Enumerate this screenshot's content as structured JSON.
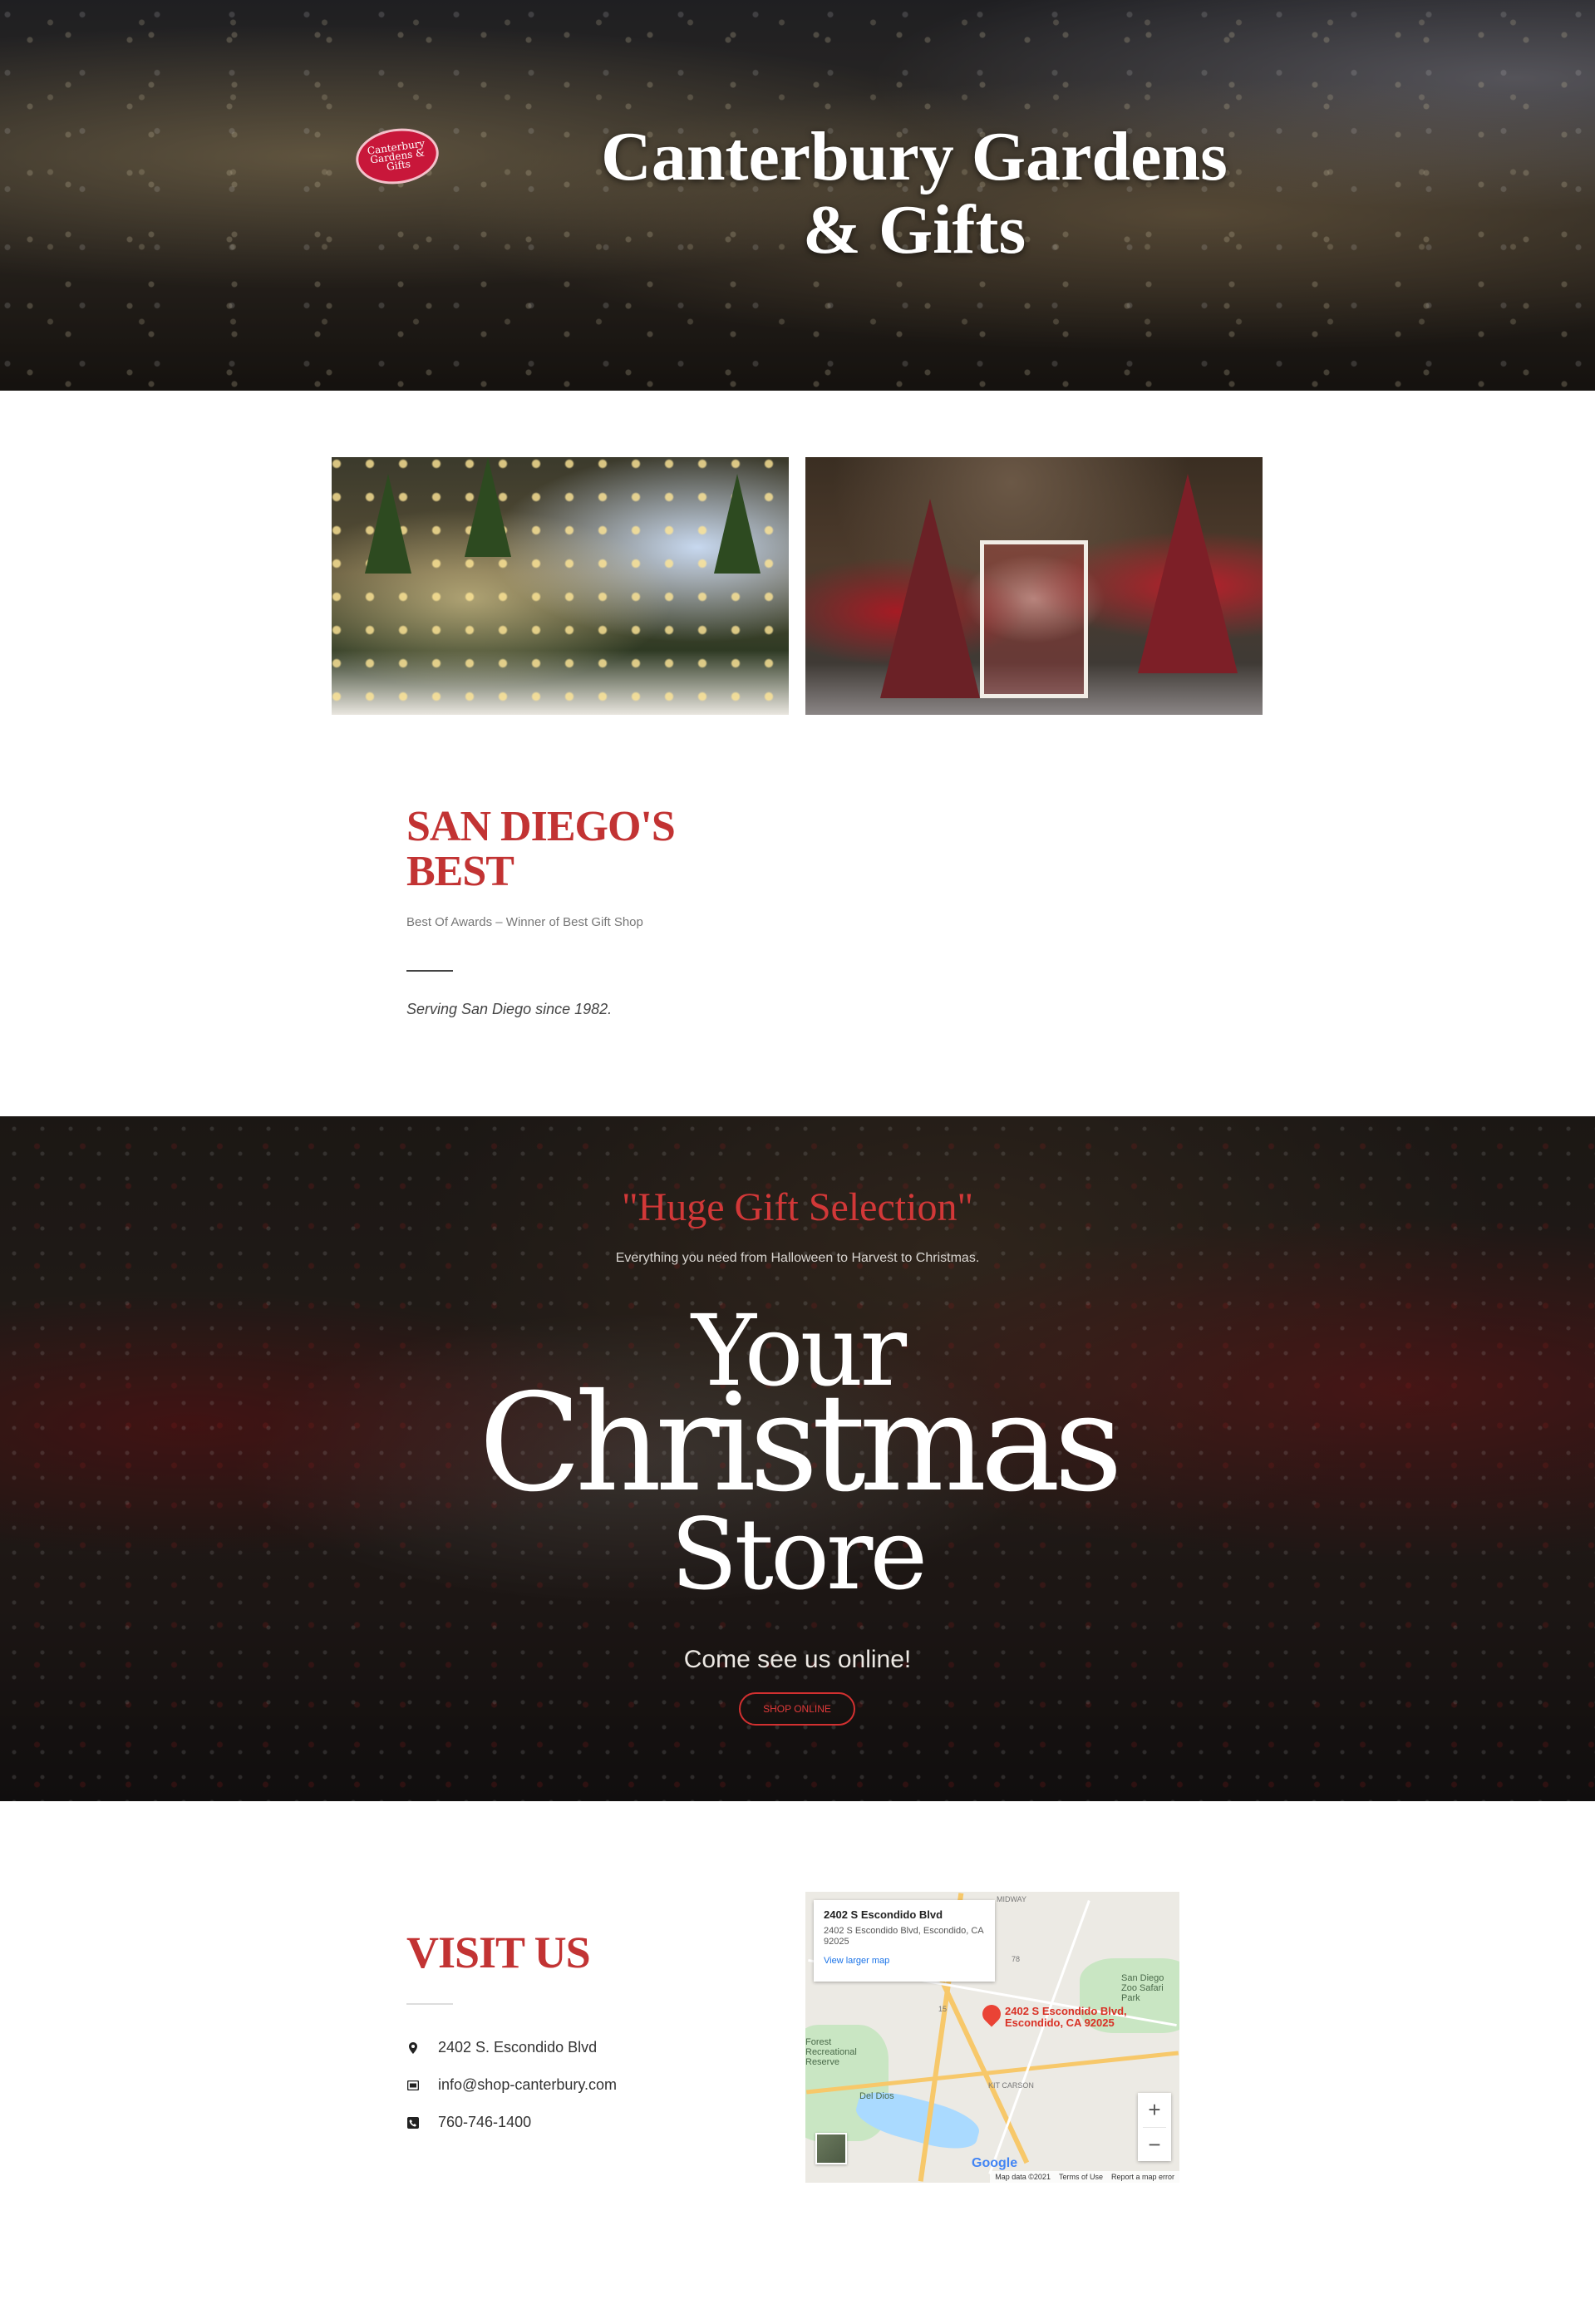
{
  "header": {
    "logo_text": "Canterbury Gardens & Gifts",
    "title_line1": "Canterbury Gardens",
    "title_line2": "& Gifts"
  },
  "about": {
    "title_line1": "SAN DIEGO'S",
    "title_line2": "BEST",
    "subtitle": "Best Of Awards – Winner of Best Gift Shop",
    "tagline": "Serving San Diego since 1982."
  },
  "promo": {
    "quote": "\"Huge Gift Selection\"",
    "quote_sub": "Everything you need from Halloween to Harvest to Christmas.",
    "big_line1": "Your",
    "big_line2": "Christmas",
    "big_line3": "Store",
    "come_see": "Come see us online!",
    "shop_button": "SHOP ONLINE"
  },
  "visit": {
    "title": "VISIT US",
    "address": "2402 S. Escondido Blvd",
    "email": "info@shop-canterbury.com",
    "phone": "760-746-1400"
  },
  "map": {
    "card_title": "2402 S Escondido Blvd",
    "card_address": "2402 S Escondido Blvd, Escondido, CA 92025",
    "card_link": "View larger map",
    "pin_line1": "2402 S Escondido Blvd,",
    "pin_line2": "Escondido, CA 92025",
    "label_midway": "MIDWAY",
    "label_zoo": "San Diego Zoo Safari Park",
    "label_forest": "Forest Recreational Reserve",
    "label_deldios": "Del Dios",
    "label_kitcarson": "KIT CARSON",
    "route_15": "15",
    "route_78": "78",
    "zoom_in": "+",
    "zoom_out": "−",
    "google": "Google",
    "footer_data": "Map data ©2021",
    "footer_terms": "Terms of Use",
    "footer_report": "Report a map error"
  },
  "colors": {
    "accent_red": "#c23333",
    "button_red": "#d23030"
  },
  "icons": {
    "address": "map-marker-icon",
    "email": "envelope-icon",
    "phone": "phone-icon"
  }
}
